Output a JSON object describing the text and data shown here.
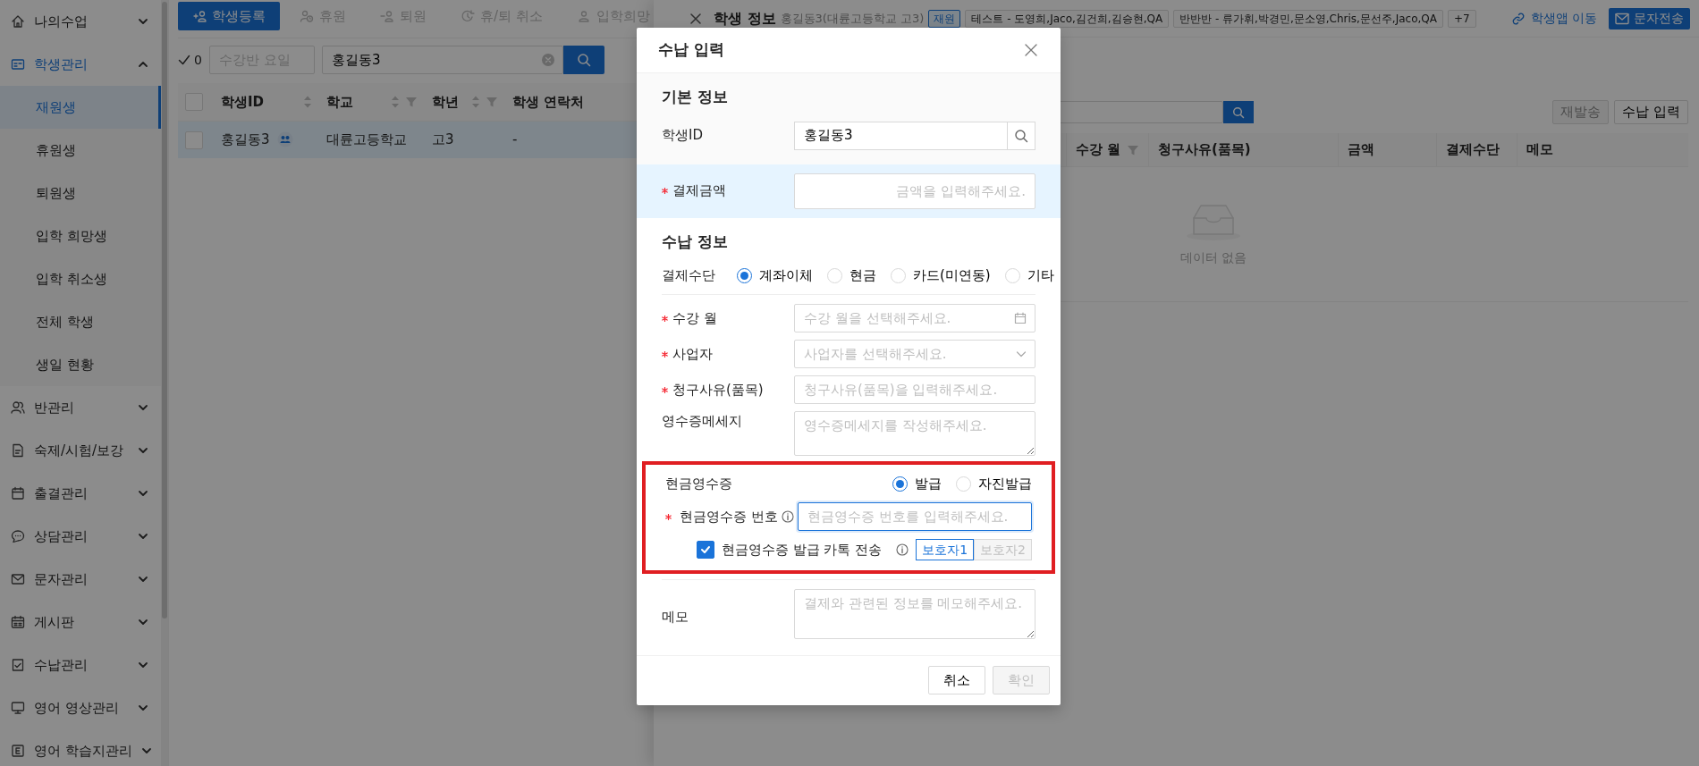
{
  "sidebar": {
    "items": [
      {
        "label": "나의수업",
        "expanded": false,
        "selected": false
      },
      {
        "label": "학생관리",
        "expanded": true,
        "selected": true,
        "children": [
          {
            "label": "재원생",
            "selected": true
          },
          {
            "label": "휴원생",
            "selected": false
          },
          {
            "label": "퇴원생",
            "selected": false
          },
          {
            "label": "입학 희망생",
            "selected": false
          },
          {
            "label": "입학 취소생",
            "selected": false
          },
          {
            "label": "전체 학생",
            "selected": false
          },
          {
            "label": "생일 현황",
            "selected": false
          }
        ]
      },
      {
        "label": "반관리",
        "expanded": false,
        "selected": false
      },
      {
        "label": "숙제/시험/보강",
        "expanded": false,
        "selected": false
      },
      {
        "label": "출결관리",
        "expanded": false,
        "selected": false
      },
      {
        "label": "상담관리",
        "expanded": false,
        "selected": false
      },
      {
        "label": "문자관리",
        "expanded": false,
        "selected": false
      },
      {
        "label": "게시판",
        "expanded": false,
        "selected": false
      },
      {
        "label": "수납관리",
        "expanded": false,
        "selected": false
      },
      {
        "label": "영어 영상관리",
        "expanded": false,
        "selected": false
      },
      {
        "label": "영어 학습지관리",
        "expanded": false,
        "selected": false
      }
    ]
  },
  "student_list": {
    "toolbar": [
      {
        "label": "학생등록",
        "kind": "primary",
        "disabled": false
      },
      {
        "label": "휴원",
        "kind": "plain",
        "disabled": true
      },
      {
        "label": "퇴원",
        "kind": "plain",
        "disabled": true
      },
      {
        "label": "휴/퇴 취소",
        "kind": "plain",
        "disabled": true
      },
      {
        "label": "입학희망",
        "kind": "plain",
        "disabled": true
      }
    ],
    "selected_count": "0",
    "day_filter": {
      "placeholder": "수강반 요일"
    },
    "search": {
      "value": "홍길동3"
    },
    "table": {
      "select_all_checked": false,
      "columns": [
        {
          "label": "학생ID",
          "sortable": true,
          "filterable": false
        },
        {
          "label": "학교",
          "sortable": true,
          "filterable": true
        },
        {
          "label": "학년",
          "sortable": true,
          "filterable": true
        },
        {
          "label": "학생 연락처",
          "sortable": false,
          "filterable": false
        }
      ],
      "rows": [
        {
          "selected": true,
          "checked": false,
          "cells": [
            "홍길동3",
            "대륜고등학교",
            "고3",
            "-"
          ]
        }
      ]
    }
  },
  "student_drawer": {
    "title": "학생 정보",
    "subtitle": "홍길동3(대륜고등학교 고3)",
    "status": "재원",
    "classes": [
      "테스트 - 도영희,Jaco,김건희,김승현,QA",
      "반반반 - 류가휘,박경민,문소영,Chris,문선주,Jaco,QA"
    ],
    "more": "+7",
    "app_link": "학생앱 이동",
    "sms_button": "문자전송",
    "actions": [
      {
        "label": "재발송",
        "disabled": true
      },
      {
        "label": "수납 입력",
        "disabled": false
      }
    ],
    "table": {
      "columns": [
        {
          "label": "수강 월",
          "filterable": true
        },
        {
          "label": "청구사유(품목)",
          "filterable": false
        },
        {
          "label": "금액",
          "filterable": false
        },
        {
          "label": "결제수단",
          "filterable": false
        },
        {
          "label": "메모",
          "filterable": false
        }
      ],
      "empty_text": "데이터 없음"
    }
  },
  "modal": {
    "title": "수납 입력",
    "basic": {
      "heading": "기본 정보",
      "student_id": {
        "label": "학생ID",
        "value": "홍길동3"
      }
    },
    "amount": {
      "label": "결제금액",
      "required": true,
      "placeholder": "금액을 입력해주세요."
    },
    "payment": {
      "heading": "수납 정보",
      "method": {
        "label": "결제수단",
        "options": [
          {
            "label": "계좌이체",
            "selected": true
          },
          {
            "label": "현금",
            "selected": false
          },
          {
            "label": "카드(미연동)",
            "selected": false
          },
          {
            "label": "기타",
            "selected": false
          }
        ]
      },
      "fields": [
        {
          "kind": "date",
          "label": "수강 월",
          "required": true,
          "placeholder": "수강 월을 선택해주세요."
        },
        {
          "kind": "select",
          "label": "사업자",
          "required": true,
          "placeholder": "사업자를 선택해주세요."
        },
        {
          "kind": "text",
          "label": "청구사유(품목)",
          "required": true,
          "placeholder": "청구사유(품목)을 입력해주세요."
        },
        {
          "kind": "textarea",
          "label": "영수증메세지",
          "required": false,
          "placeholder": "영수증메세지를 작성해주세요."
        }
      ]
    },
    "cash_receipt": {
      "highlighted": true,
      "label": "현금영수증",
      "options": [
        {
          "label": "발급",
          "selected": true
        },
        {
          "label": "자진발급",
          "selected": false
        }
      ],
      "number": {
        "label": "현금영수증 번호",
        "required": true,
        "placeholder": "현금영수증 번호를 입력해주세요.",
        "focused": true
      },
      "kakao": {
        "label": "현금영수증 발급 카톡 전송",
        "checked": true
      },
      "guardians": [
        {
          "label": "보호자1",
          "selected": true
        },
        {
          "label": "보호자2",
          "selected": false
        }
      ]
    },
    "memo": {
      "label": "메모",
      "placeholder": "결제와 관련된 정보를 메모해주세요."
    },
    "buttons": [
      {
        "label": "취소",
        "disabled": false
      },
      {
        "label": "확인",
        "disabled": true
      }
    ]
  }
}
